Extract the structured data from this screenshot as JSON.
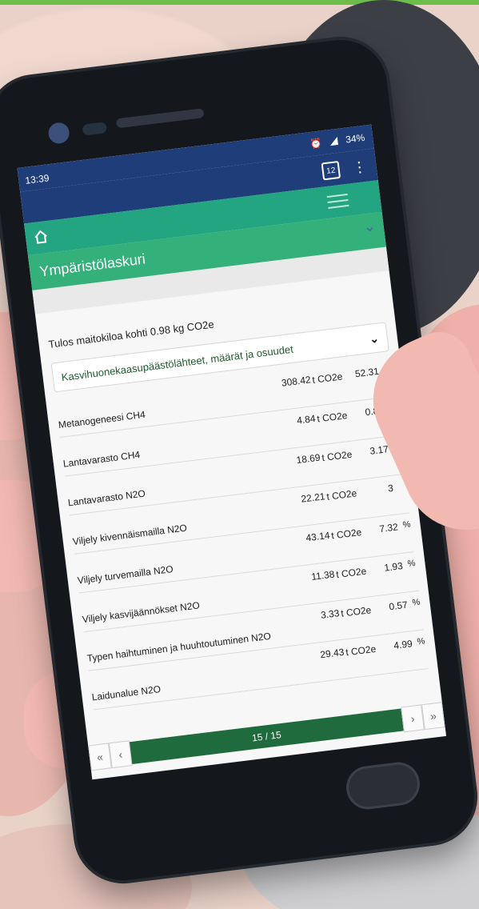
{
  "status_bar": {
    "time": "13:39",
    "battery": "34%"
  },
  "app": {
    "tab_count": "12",
    "section_title": "Ympäristölaskuri",
    "result_text": "Tulos maitokiloa kohti 0.98 kg CO2e",
    "accordion_title": "Kasvihuonekaasupäästölähteet, määrät ja osuudet"
  },
  "rows": [
    {
      "name": "Metanogeneesi CH4",
      "value": "308.42",
      "unit": "t CO2e",
      "percent": "52.31",
      "pct_sign": "%"
    },
    {
      "name": "Lantavarasto CH4",
      "value": "4.84",
      "unit": "t CO2e",
      "percent": "0.82",
      "pct_sign": "%"
    },
    {
      "name": "Lantavarasto N2O",
      "value": "18.69",
      "unit": "t CO2e",
      "percent": "3.17",
      "pct_sign": "%"
    },
    {
      "name": "Viljely kivennäismailla N2O",
      "value": "22.21",
      "unit": "t CO2e",
      "percent": "3",
      "pct_sign": ""
    },
    {
      "name": "Viljely turvemailla N2O",
      "value": "43.14",
      "unit": "t CO2e",
      "percent": "7.32",
      "pct_sign": "%"
    },
    {
      "name": "Viljely kasvijäännökset N2O",
      "value": "11.38",
      "unit": "t CO2e",
      "percent": "1.93",
      "pct_sign": "%"
    },
    {
      "name": "Typen haihtuminen ja huuhtoutuminen N2O",
      "value": "3.33",
      "unit": "t CO2e",
      "percent": "0.57",
      "pct_sign": "%"
    },
    {
      "name": "Laidunalue N2O",
      "value": "29.43",
      "unit": "t CO2e",
      "percent": "4.99",
      "pct_sign": "%"
    }
  ],
  "pager": {
    "label": "15 / 15",
    "first": "«",
    "prev": "‹",
    "next": "›",
    "last": "»"
  },
  "colors": {
    "status_blue": "#1f3d78",
    "app_green": "#22a580",
    "section_green": "#34b07a",
    "pager_green": "#1f6b3e"
  },
  "icons": {
    "home": "home-icon",
    "tabs": "tab-count-icon",
    "menu": "kebab-menu-icon",
    "hamburger": "hamburger-menu-icon",
    "collapse": "chevron-down-icon"
  }
}
